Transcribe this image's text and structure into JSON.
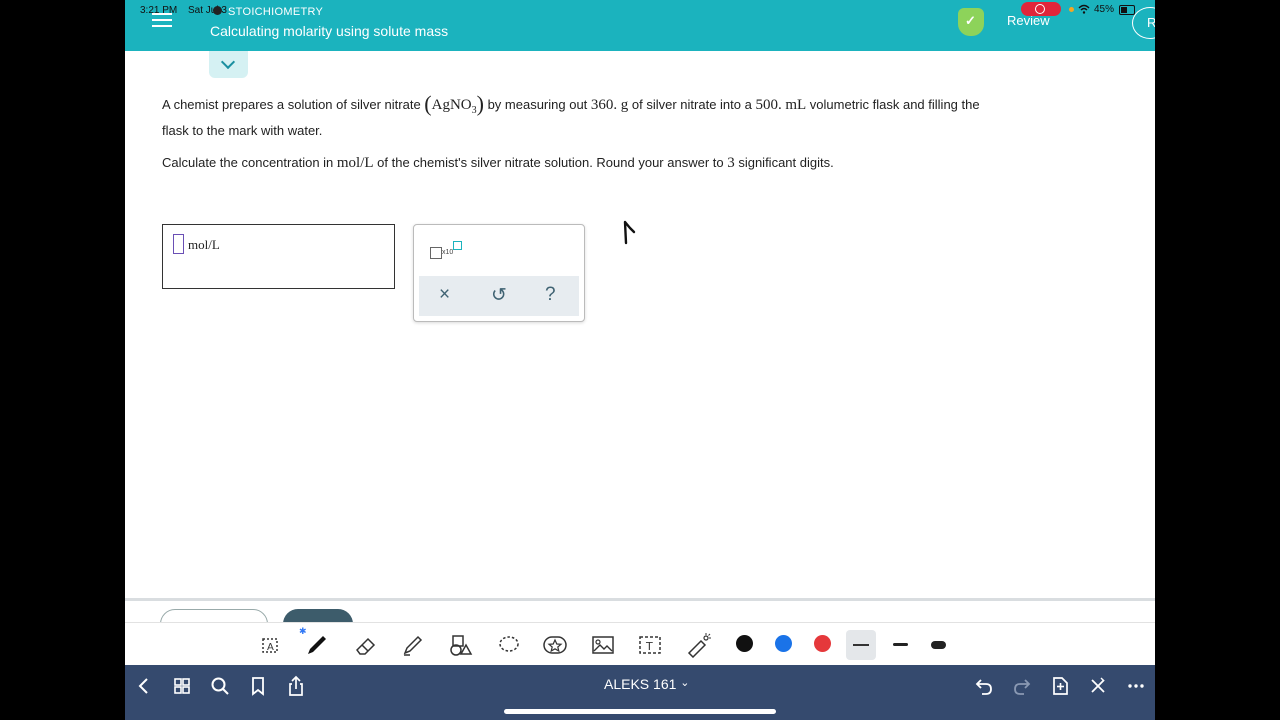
{
  "status_bar": {
    "time": "3:21 PM",
    "date": "Sat Jul 3",
    "battery": "45%"
  },
  "header": {
    "category": "STOICHIOMETRY",
    "title": "Calculating molarity using solute mass",
    "review_label": "Review",
    "avatar_initial": "R"
  },
  "problem": {
    "part1": "A chemist prepares a solution of silver nitrate ",
    "formula_main": "AgNO",
    "formula_sub": "3",
    "part2": " by measuring out ",
    "mass": "360.",
    "mass_unit": "g",
    "part3": " of silver nitrate into a ",
    "volume": "500.",
    "volume_unit": "mL",
    "part4": " volumetric flask and filling the",
    "line2": "flask to the mark with water.",
    "q_part1": "Calculate the concentration in ",
    "q_unit": "mol/L",
    "q_part2": " of the chemist's silver nitrate solution. Round your answer to ",
    "q_digits": "3",
    "q_part3": " significant digits."
  },
  "answer": {
    "value": "",
    "unit": "mol/L"
  },
  "palette": {
    "sci_label": "x10",
    "clear_symbol": "×",
    "undo_symbol": "↺",
    "help_symbol": "?"
  },
  "markup_toolbar": {
    "bluetooth_symbol": "✱",
    "colors": [
      "#111111",
      "#1a73e8",
      "#e5383b"
    ]
  },
  "nav": {
    "title": "ALEKS 161",
    "chevron": "⌄"
  }
}
